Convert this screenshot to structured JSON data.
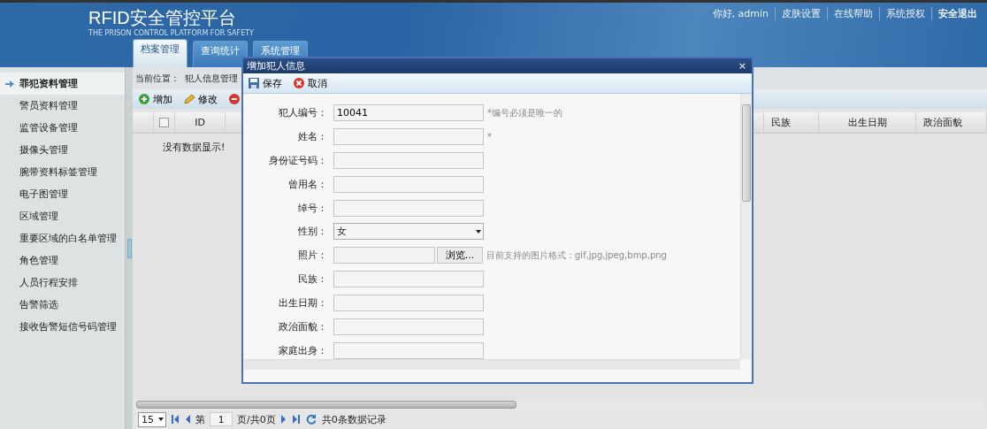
{
  "header": {
    "title": "RFID安全管控平台",
    "subtitle": "THE PRISON CONTROL PLATFORM FOR SAFETY",
    "links": [
      "你好, admin",
      "皮肤设置",
      "在线帮助",
      "系统授权",
      "安全退出"
    ]
  },
  "tabs": [
    {
      "label": "档案管理",
      "selected": true
    },
    {
      "label": "查询统计",
      "selected": false
    },
    {
      "label": "系统管理",
      "selected": false
    }
  ],
  "sidebar": {
    "items": [
      {
        "label": "罪犯资料管理",
        "selected": true
      },
      {
        "label": "警员资料管理",
        "selected": false
      },
      {
        "label": "监管设备管理",
        "selected": false
      },
      {
        "label": "摄像头管理",
        "selected": false
      },
      {
        "label": "腕带资料标签管理",
        "selected": false
      },
      {
        "label": "电子图管理",
        "selected": false
      },
      {
        "label": "区域管理",
        "selected": false
      },
      {
        "label": "重要区域的白名单管理",
        "selected": false
      },
      {
        "label": "角色管理",
        "selected": false
      },
      {
        "label": "人员行程安排",
        "selected": false
      },
      {
        "label": "告警筛选",
        "selected": false
      },
      {
        "label": "接收告警短信号码管理",
        "selected": false
      }
    ]
  },
  "breadcrumb": {
    "label": "当前位置：",
    "value": "犯人信息管理"
  },
  "toolbar": [
    {
      "kind": "add",
      "label": "增加"
    },
    {
      "kind": "edit",
      "label": "修改"
    },
    {
      "kind": "delete"
    }
  ],
  "table": {
    "columns": [
      "ID",
      "民族",
      "出生日期",
      "政治面貌"
    ],
    "empty_message": "没有数据显示!"
  },
  "pager": {
    "page_size": "15",
    "page_label": "第",
    "page": "1",
    "page_total": "页/共0页",
    "summary": "共0条数据记录"
  },
  "dialog": {
    "title": "增加犯人信息",
    "close": "×",
    "buttons": [
      {
        "kind": "save",
        "label": "保存"
      },
      {
        "kind": "cancel",
        "label": "取消"
      }
    ],
    "fields": [
      {
        "kind": "text",
        "label": "犯人编号：",
        "value": "10041",
        "hint": "*编号必须是唯一的"
      },
      {
        "kind": "text",
        "label": "姓名：",
        "hint": "*"
      },
      {
        "kind": "text",
        "label": "身份证号码："
      },
      {
        "kind": "text",
        "label": "曾用名："
      },
      {
        "kind": "text",
        "label": "绰号："
      },
      {
        "kind": "select",
        "label": "性别：",
        "value": "女"
      },
      {
        "kind": "file",
        "label": "照片：",
        "button": "浏览...",
        "hint": "目前支持的图片格式：gif,jpg,jpeg,bmp,png"
      },
      {
        "kind": "text",
        "label": "民族："
      },
      {
        "kind": "text",
        "label": "出生日期："
      },
      {
        "kind": "text",
        "label": "政治面貌："
      },
      {
        "kind": "text",
        "label": "家庭出身："
      }
    ]
  }
}
